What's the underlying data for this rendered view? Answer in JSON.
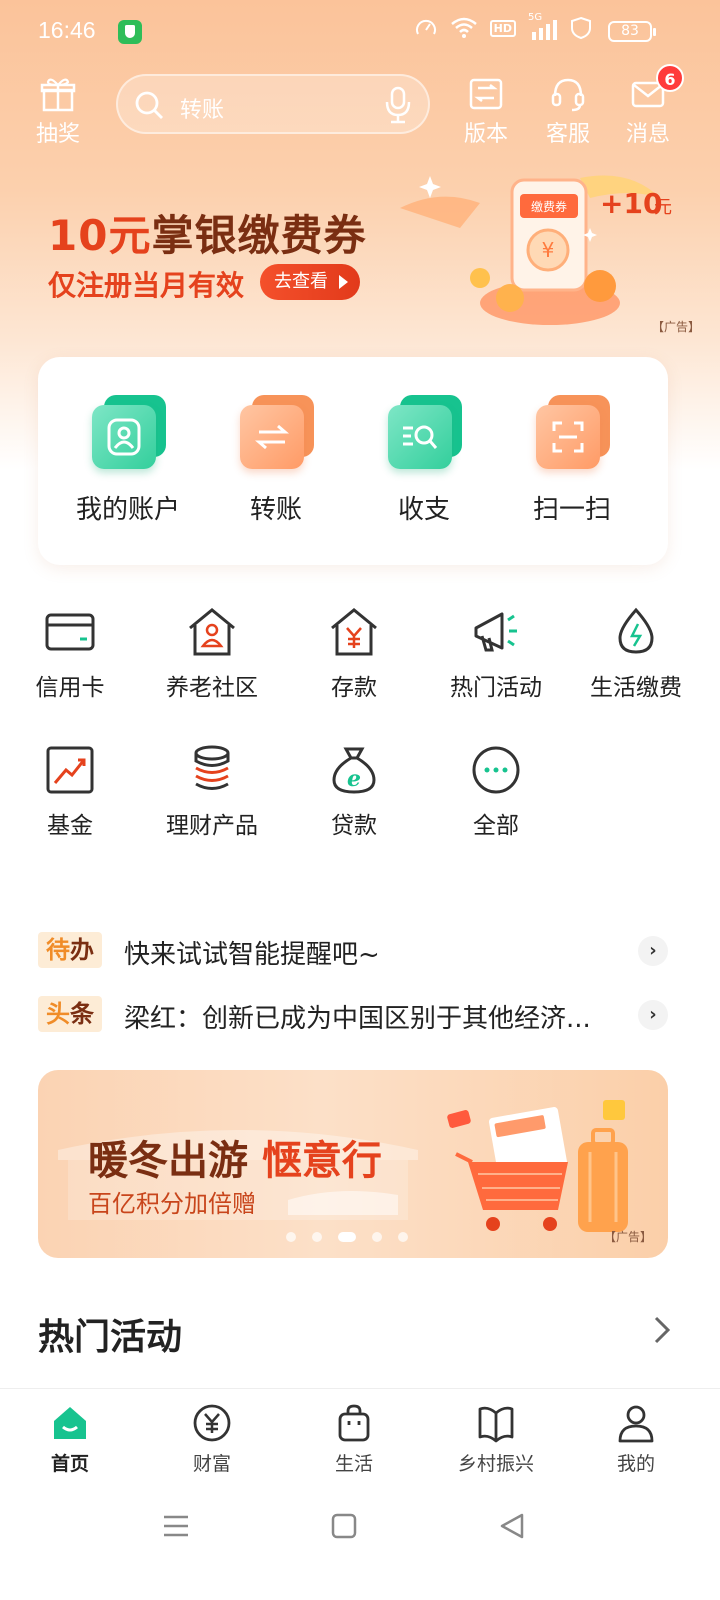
{
  "status_bar": {
    "time": "16:46",
    "network": "5G",
    "hd": "HD",
    "battery": "83"
  },
  "header": {
    "lottery_label": "抽奖",
    "search_placeholder": "转账",
    "version_label": "版本",
    "service_label": "客服",
    "messages_label": "消息",
    "messages_badge": "6"
  },
  "banner": {
    "title_highlight": "10元",
    "title_rest": "掌银缴费券",
    "subtitle": "仅注册当月有效",
    "button_label": "去查看",
    "coupon_label": "缴费券",
    "bonus": "+10",
    "bonus_unit": "元",
    "ad_label": "【广告】"
  },
  "quick_actions": [
    {
      "label": "我的账户"
    },
    {
      "label": "转账"
    },
    {
      "label": "收支"
    },
    {
      "label": "扫一扫"
    }
  ],
  "grid": [
    {
      "label": "信用卡"
    },
    {
      "label": "养老社区"
    },
    {
      "label": "存款"
    },
    {
      "label": "热门活动"
    },
    {
      "label": "生活缴费"
    },
    {
      "label": "基金"
    },
    {
      "label": "理财产品"
    },
    {
      "label": "贷款"
    },
    {
      "label": "全部"
    }
  ],
  "notices": [
    {
      "tag_first": "待",
      "tag_rest": "办",
      "text": "快来试试智能提醒吧~"
    },
    {
      "tag_first": "头",
      "tag_rest": "条",
      "text": "梁红：创新已成为中国区别于其他经济..."
    }
  ],
  "promo": {
    "title_a": "暖冬出游",
    "title_b": "惬意行",
    "subtitle": "百亿积分加倍赠",
    "ad_label": "【广告】",
    "slide_count": 5,
    "active_slide": 3
  },
  "section": {
    "title": "热门活动"
  },
  "bottom_nav": [
    {
      "label": "首页",
      "active": true
    },
    {
      "label": "财富"
    },
    {
      "label": "生活"
    },
    {
      "label": "乡村振兴"
    },
    {
      "label": "我的"
    }
  ],
  "colors": {
    "brand_green": "#17c38f",
    "accent_orange": "#f79359",
    "headline_brown": "#7a2e12",
    "accent_red": "#e5421d"
  }
}
